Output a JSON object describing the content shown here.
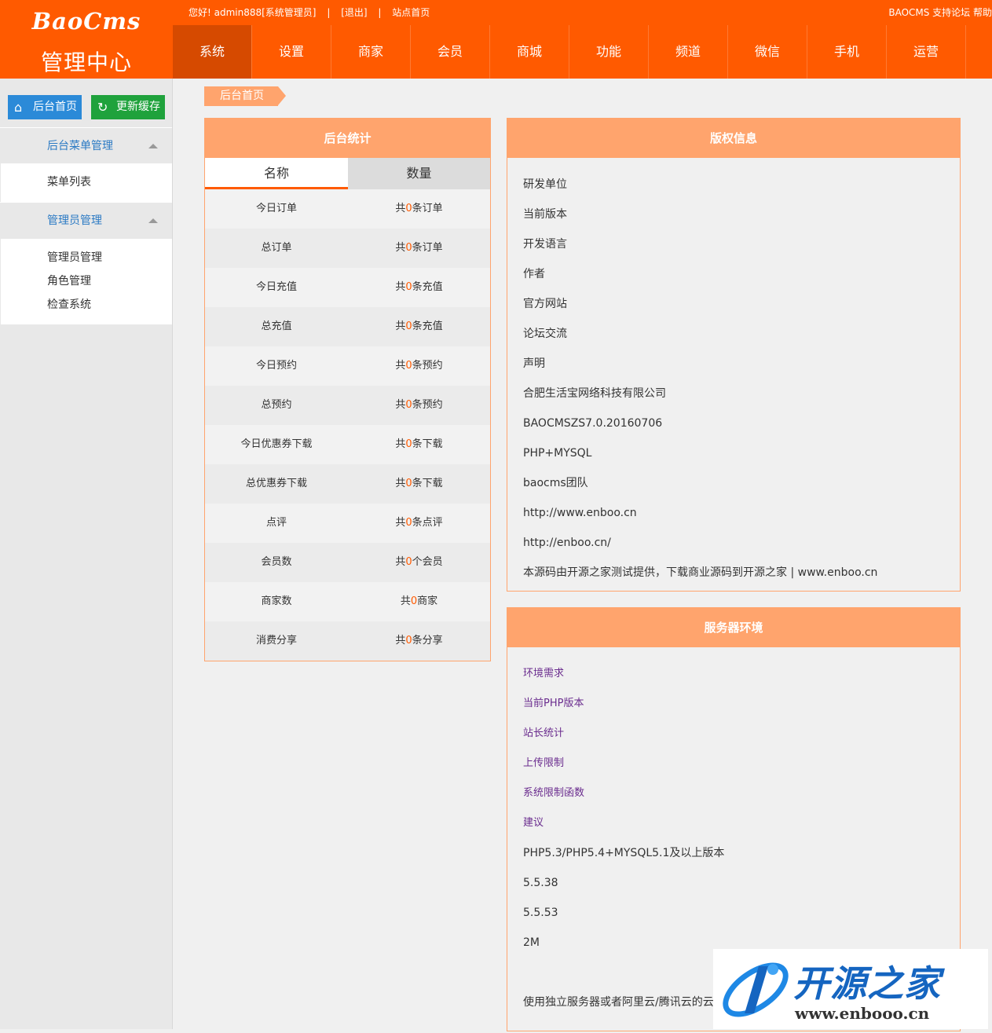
{
  "brand": {
    "logo": "BaoCms",
    "subtitle": "管理中心"
  },
  "topbar": {
    "greeting": "您好! admin888[系统管理员]",
    "sep1": "|",
    "logout": "[退出]",
    "sep2": "|",
    "site_home": "站点首页",
    "right_links": "BAOCMS 支持论坛 帮助"
  },
  "nav": [
    "系统",
    "设置",
    "商家",
    "会员",
    "商城",
    "功能",
    "频道",
    "微信",
    "手机",
    "运营"
  ],
  "sidebar": {
    "home_button": "后台首页",
    "refresh_button": "更新缓存",
    "groups": [
      {
        "title": "后台菜单管理",
        "items": [
          "菜单列表"
        ]
      },
      {
        "title": "管理员管理",
        "items": [
          "管理员管理",
          "角色管理",
          "检查系统"
        ]
      }
    ]
  },
  "breadcrumb": "后台首页",
  "stats": {
    "title": "后台统计",
    "col_name": "名称",
    "col_qty": "数量",
    "rows": [
      {
        "name": "今日订单",
        "pre": "共",
        "num": "0",
        "post": "条订单"
      },
      {
        "name": "总订单",
        "pre": "共",
        "num": "0",
        "post": "条订单"
      },
      {
        "name": "今日充值",
        "pre": "共",
        "num": "0",
        "post": "条充值"
      },
      {
        "name": "总充值",
        "pre": "共",
        "num": "0",
        "post": "条充值"
      },
      {
        "name": "今日预约",
        "pre": "共",
        "num": "0",
        "post": "条预约"
      },
      {
        "name": "总预约",
        "pre": "共",
        "num": "0",
        "post": "条预约"
      },
      {
        "name": "今日优惠券下载",
        "pre": "共",
        "num": "0",
        "post": "条下载"
      },
      {
        "name": "总优惠券下载",
        "pre": "共",
        "num": "0",
        "post": "条下载"
      },
      {
        "name": "点评",
        "pre": "共",
        "num": "0",
        "post": "条点评"
      },
      {
        "name": "会员数",
        "pre": "共",
        "num": "0",
        "post": "个会员"
      },
      {
        "name": "商家数",
        "pre": "共",
        "num": "0",
        "post": "商家"
      },
      {
        "name": "消费分享",
        "pre": "共",
        "num": "0",
        "post": "条分享"
      }
    ]
  },
  "copyright": {
    "title": "版权信息",
    "lines": [
      "研发单位",
      "当前版本",
      "开发语言",
      "作者",
      "官方网站",
      "论坛交流",
      "声明",
      "合肥生活宝网络科技有限公司",
      "BAOCMSZS7.0.20160706",
      "PHP+MYSQL",
      "baocms团队",
      "http://www.enboo.cn",
      "http://enboo.cn/",
      "本源码由开源之家测试提供，下载商业源码到开源之家 | www.enboo.cn"
    ]
  },
  "server": {
    "title": "服务器环境",
    "labels": [
      "环境需求",
      "当前PHP版本",
      "站长统计",
      "上传限制",
      "系统限制函数",
      "建议"
    ],
    "values": [
      "PHP5.3/PHP5.4+MYSQL5.1及以上版本",
      "5.5.38",
      "5.5.53",
      "2M",
      "",
      "使用独立服务器或者阿里云/腾讯云的云"
    ]
  },
  "watermark": {
    "name": "开源之家",
    "url": "www.enbooo.cn"
  },
  "colors": {
    "primary": "#ff5a00",
    "panel": "#ffa46d",
    "active_nav": "#d64a00",
    "home_btn": "#2b8ad8",
    "refresh_btn": "#1fa23c"
  }
}
